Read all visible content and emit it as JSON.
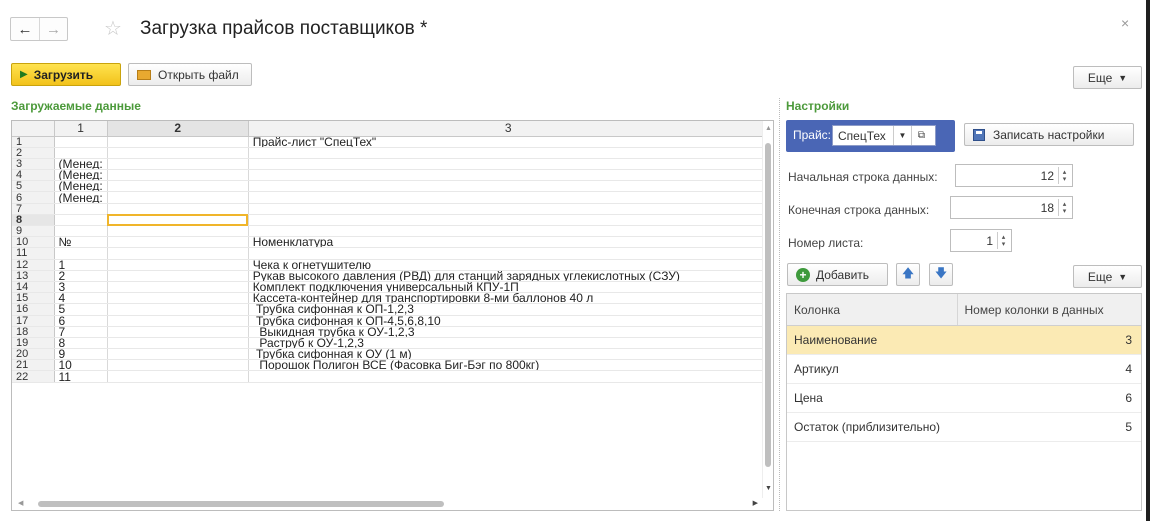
{
  "header": {
    "title": "Загрузка прайсов поставщиков *",
    "back_glyph": "←",
    "forward_glyph": "→",
    "close_glyph": "×"
  },
  "toolbar": {
    "load_label": "Загрузить",
    "open_file_label": "Открыть файл",
    "more_label": "Еще"
  },
  "data_section": {
    "title": "Загружаемые данные",
    "columns": [
      "1",
      "2",
      "3"
    ],
    "selected_row": "8",
    "rows": [
      {
        "n": "1",
        "c1": "",
        "c2": "",
        "c3": "Прайс-лист \"СпецТех\""
      },
      {
        "n": "2",
        "c1": "",
        "c2": "",
        "c3": ""
      },
      {
        "n": "3",
        "c1": "(Менед:",
        "c2": "",
        "c3": ""
      },
      {
        "n": "4",
        "c1": "(Менед:",
        "c2": "",
        "c3": ""
      },
      {
        "n": "5",
        "c1": "(Менед:",
        "c2": "",
        "c3": ""
      },
      {
        "n": "6",
        "c1": "(Менед:",
        "c2": "",
        "c3": ""
      },
      {
        "n": "7",
        "c1": "",
        "c2": "",
        "c3": ""
      },
      {
        "n": "8",
        "c1": "",
        "c2": "",
        "c3": ""
      },
      {
        "n": "9",
        "c1": "",
        "c2": "",
        "c3": ""
      },
      {
        "n": "10",
        "c1": "№",
        "c2": "",
        "c3": "Номенклатура"
      },
      {
        "n": "11",
        "c1": "",
        "c2": "",
        "c3": ""
      },
      {
        "n": "12",
        "c1": "1",
        "c2": "",
        "c3": "Чека к огнетушителю"
      },
      {
        "n": "13",
        "c1": "2",
        "c2": "",
        "c3": "Рукав высокого давления (РВД) для станций зарядных углекислотных (СЗУ)"
      },
      {
        "n": "14",
        "c1": "3",
        "c2": "",
        "c3": "Комплект подключения универсальный КПУ-1П"
      },
      {
        "n": "15",
        "c1": "4",
        "c2": "",
        "c3": "Кассета-контейнер для транспортировки 8-ми баллонов 40 л"
      },
      {
        "n": "16",
        "c1": "5",
        "c2": "",
        "c3": " Трубка сифонная к ОП-1,2,3"
      },
      {
        "n": "17",
        "c1": "6",
        "c2": "",
        "c3": " Трубка сифонная к ОП-4,5,6,8,10"
      },
      {
        "n": "18",
        "c1": "7",
        "c2": "",
        "c3": "  Выкидная трубка к ОУ-1,2,3"
      },
      {
        "n": "19",
        "c1": "8",
        "c2": "",
        "c3": "  Раструб к ОУ-1,2,3"
      },
      {
        "n": "20",
        "c1": "9",
        "c2": "",
        "c3": " Трубка сифонная к ОУ (1 м)"
      },
      {
        "n": "21",
        "c1": "10",
        "c2": "",
        "c3": "  Порошок Полигон ВСЕ (Фасовка Биг-Бэг по 800кг)"
      },
      {
        "n": "22",
        "c1": "11",
        "c2": "",
        "c3": ""
      }
    ]
  },
  "settings": {
    "title": "Настройки",
    "price_label": "Прайс:",
    "price_value": "СпецТех",
    "save_label": "Записать настройки",
    "start_row_label": "Начальная строка данных:",
    "start_row_value": "12",
    "end_row_label": "Конечная строка данных:",
    "end_row_value": "18",
    "sheet_label": "Номер листа:",
    "sheet_value": "1",
    "add_label": "Добавить",
    "more_label": "Еще",
    "columns_table": {
      "header_col": "Колонка",
      "header_num": "Номер колонки в данных",
      "rows": [
        {
          "name": "Наименование",
          "num": "3"
        },
        {
          "name": "Артикул",
          "num": "4"
        },
        {
          "name": "Цена",
          "num": "6"
        },
        {
          "name": "Остаток (приблизительно)",
          "num": "5"
        }
      ]
    }
  }
}
